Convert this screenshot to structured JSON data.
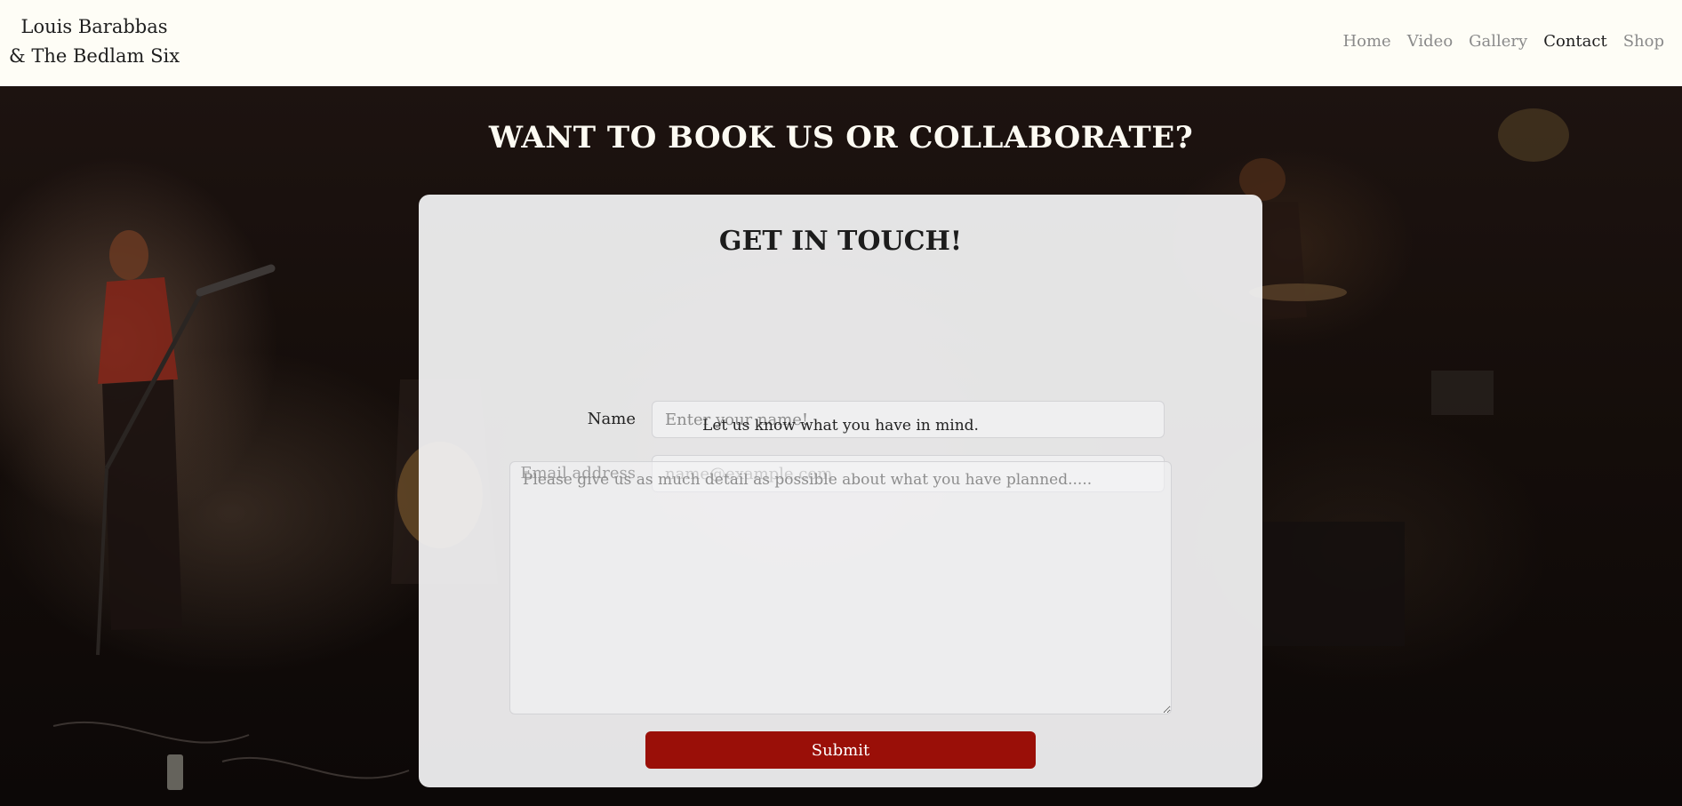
{
  "brand": {
    "line1": "Louis Barabbas",
    "line2": "& The Bedlam Six"
  },
  "nav": {
    "items": [
      {
        "label": "Home"
      },
      {
        "label": "Video"
      },
      {
        "label": "Gallery"
      },
      {
        "label": "Contact",
        "active": true
      },
      {
        "label": "Shop"
      }
    ]
  },
  "hero": {
    "title": "WANT TO BOOK US OR COLLABORATE?"
  },
  "form": {
    "title": "GET IN TOUCH!",
    "name_label": "Name",
    "name_placeholder": "Enter your name!",
    "name_value": "",
    "email_label": "Email address",
    "email_placeholder": "name@example.com",
    "email_value": "",
    "message_prompt": "Let us know what you have in mind.",
    "message_placeholder": "Please give us as much detail as possible about what you have planned.....",
    "message_value": "",
    "submit_label": "Submit"
  },
  "colors": {
    "navbar_bg": "#fefdf6",
    "submit_bg": "#9a0f08",
    "hero_title": "#fdfbf3"
  }
}
